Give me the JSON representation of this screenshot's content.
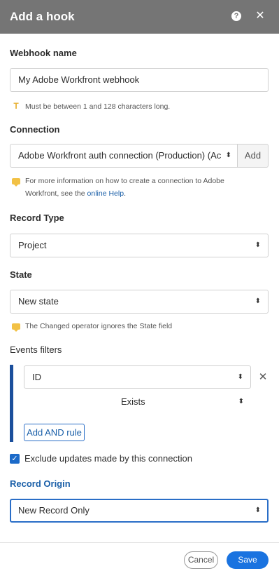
{
  "dialog": {
    "title": "Add a hook",
    "help_icon": "question-circle-icon",
    "help_glyph": "?",
    "close_icon": "close-icon",
    "close_glyph": "✕"
  },
  "webhook_name": {
    "label": "Webhook name",
    "value": "My Adobe Workfront webhook",
    "hint_icon": "text-icon",
    "hint_glyph": "T",
    "hint": "Must be between 1 and 128 characters long."
  },
  "connection": {
    "label": "Connection",
    "value": "Adobe Workfront auth connection (Production) (Ac",
    "add_label": "Add",
    "hint_icon": "info-bubble-icon",
    "hint_prefix": "For more information on how to create a connection to Adobe Workfront, see the",
    "hint_link": "online Help",
    "hint_suffix": "."
  },
  "record_type": {
    "label": "Record Type",
    "value": "Project"
  },
  "state": {
    "label": "State",
    "value": "New state",
    "hint": "The Changed operator ignores the State field"
  },
  "events_filters": {
    "label": "Events filters",
    "field_value": "ID",
    "operator_value": "Exists",
    "remove_glyph": "✕",
    "add_and_rule_label": "Add AND rule"
  },
  "exclude_updates": {
    "checked": true,
    "check_glyph": "✓",
    "label": "Exclude updates made by this connection"
  },
  "record_origin": {
    "label": "Record Origin",
    "value": "New Record Only"
  },
  "footer": {
    "cancel_label": "Cancel",
    "save_label": "Save"
  },
  "select_caret_glyph": "⬍",
  "colors": {
    "header_bg": "#757575",
    "accent": "#1a73e0",
    "filter_bar": "#1b4f9c",
    "hint_icon": "#f2c145"
  }
}
